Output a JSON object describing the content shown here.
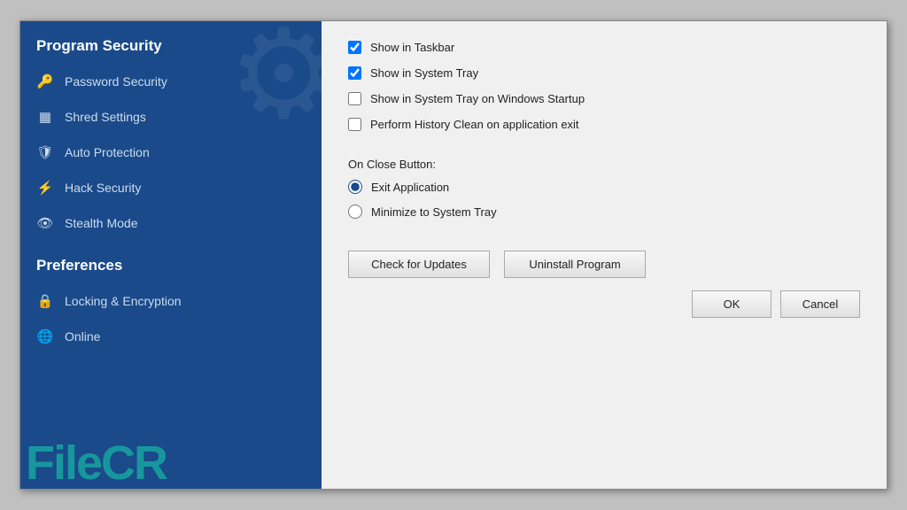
{
  "sidebar": {
    "section1_title": "Program Security",
    "items": [
      {
        "id": "password-security",
        "label": "Password Security",
        "icon": "🔑"
      },
      {
        "id": "shred-settings",
        "label": "Shred Settings",
        "icon": "⊞"
      },
      {
        "id": "auto-protection",
        "label": "Auto Protection",
        "icon": "🛡"
      },
      {
        "id": "hack-security",
        "label": "Hack Security",
        "icon": "⚡"
      },
      {
        "id": "stealth-mode",
        "label": "Stealth Mode",
        "icon": "👁"
      }
    ],
    "section2_title": "Preferences",
    "items2": [
      {
        "id": "locking-encryption",
        "label": "Locking & Encryption",
        "icon": "🔒"
      },
      {
        "id": "online",
        "label": "Online",
        "icon": "🌐"
      }
    ]
  },
  "main": {
    "checkboxes": [
      {
        "id": "show-taskbar",
        "label": "Show in Taskbar",
        "checked": true
      },
      {
        "id": "show-systray",
        "label": "Show in System Tray",
        "checked": true
      },
      {
        "id": "show-systray-startup",
        "label": "Show in System Tray on Windows Startup",
        "checked": false
      },
      {
        "id": "perform-history-clean",
        "label": "Perform History Clean on application exit",
        "checked": false
      }
    ],
    "on_close_label": "On Close Button:",
    "radios": [
      {
        "id": "exit-app",
        "label": "Exit Application",
        "checked": true
      },
      {
        "id": "minimize-systray",
        "label": "Minimize to System Tray",
        "checked": false
      }
    ],
    "buttons_row1": [
      {
        "id": "check-updates",
        "label": "Check for Updates"
      },
      {
        "id": "uninstall",
        "label": "Uninstall Program"
      }
    ],
    "buttons_row2": [
      {
        "id": "ok",
        "label": "OK"
      },
      {
        "id": "cancel",
        "label": "Cancel"
      }
    ]
  },
  "watermark": "FileCR"
}
